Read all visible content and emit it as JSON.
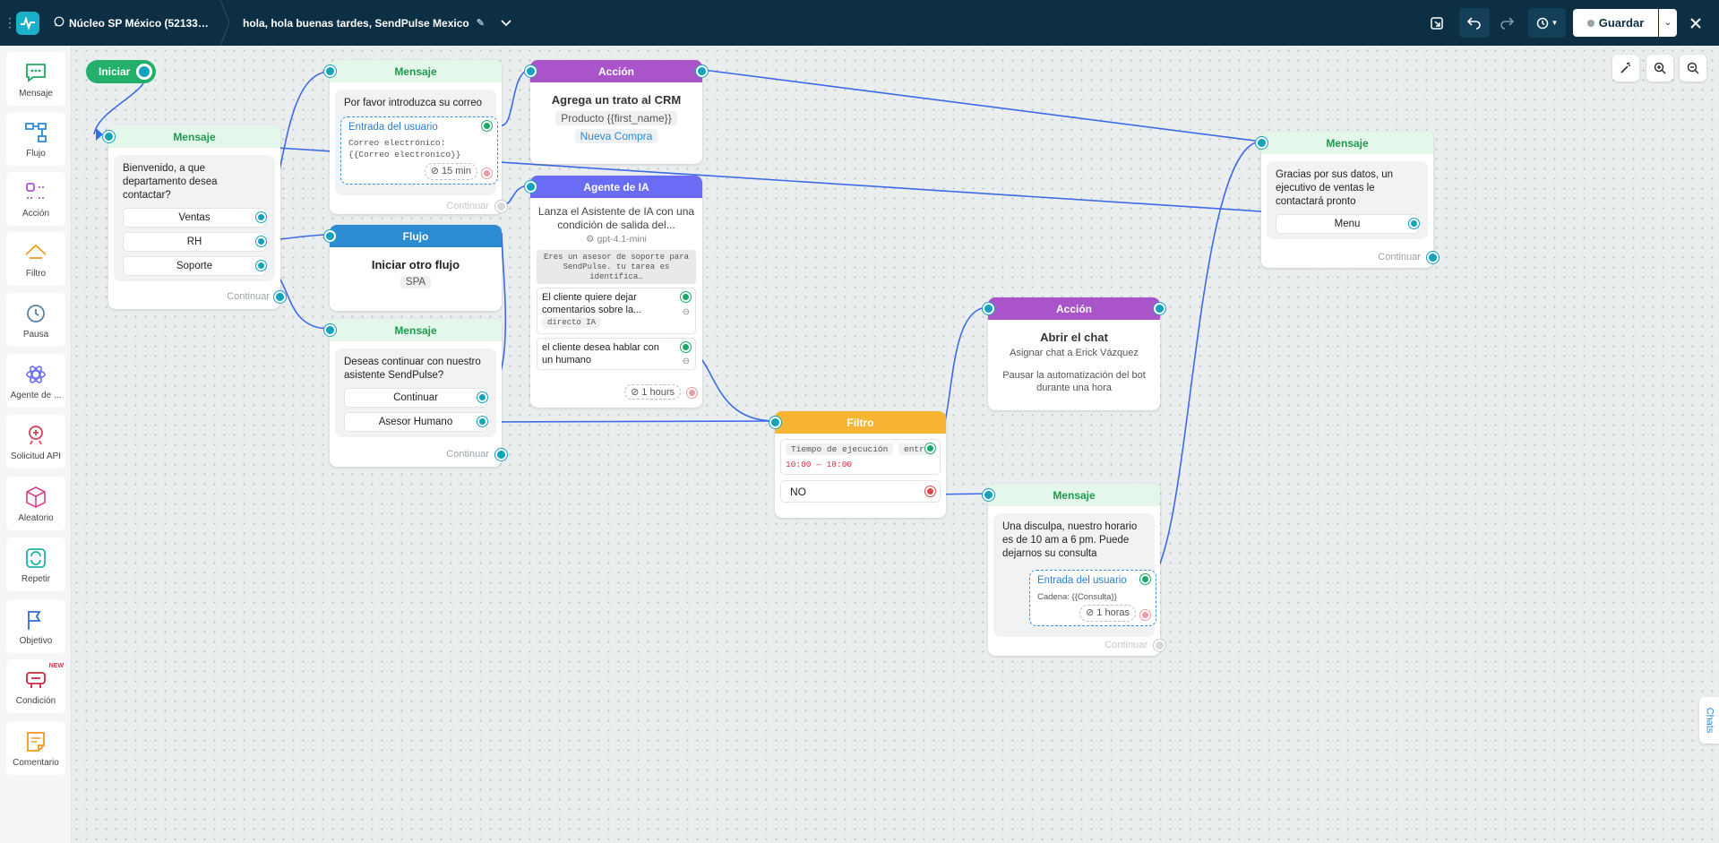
{
  "topbar": {
    "workspace": "Núcleo SP México (52133…",
    "flow_title": "hola, hola buenas tardes, SendPulse Mexico",
    "save_label": "Guardar"
  },
  "sidebar": {
    "items": [
      {
        "label": "Mensaje",
        "icon": "message-icon"
      },
      {
        "label": "Flujo",
        "icon": "flow-icon"
      },
      {
        "label": "Acción",
        "icon": "action-icon"
      },
      {
        "label": "Filtro",
        "icon": "filter-icon"
      },
      {
        "label": "Pausa",
        "icon": "clock-icon"
      },
      {
        "label": "Agente de ...",
        "icon": "ai-agent-icon"
      },
      {
        "label": "Solicitud API",
        "icon": "api-icon"
      },
      {
        "label": "Aleatorio",
        "icon": "dice-icon"
      },
      {
        "label": "Repetir",
        "icon": "repeat-icon"
      },
      {
        "label": "Objetivo",
        "icon": "flag-icon"
      },
      {
        "label": "Condición",
        "icon": "condition-icon",
        "badge": "NEW"
      },
      {
        "label": "Comentario",
        "icon": "comment-icon"
      }
    ]
  },
  "canvas": {
    "start_label": "Iniciar",
    "chats_tab": "Chats",
    "continue_label": "Continuar",
    "msg1": {
      "header": "Mensaje",
      "text": "Bienvenido, a que departamento desea contactar?",
      "buttons": [
        "Ventas",
        "RH",
        "Soporte"
      ]
    },
    "msg2": {
      "header": "Mensaje",
      "text": "Por favor introduzca su correo",
      "input_title": "Entrada del usuario",
      "input_body": "Correo electrónico: {{Correo electronico}}",
      "timer": "15 min"
    },
    "flow1": {
      "header": "Flujo",
      "title": "Iniciar otro flujo",
      "chip": "SPA"
    },
    "msg3": {
      "header": "Mensaje",
      "text": "Deseas continuar con nuestro asistente SendPulse?",
      "buttons": [
        "Continuar",
        "Asesor Humano"
      ]
    },
    "act1": {
      "header": "Acción",
      "title": "Agrega un trato al CRM",
      "product": "Producto {{first_name}}",
      "stage": "Nueva Compra"
    },
    "ai1": {
      "header": "Agente de IA",
      "text": "Lanza el Asistente de IA con una condición de salida del...",
      "model": "gpt-4.1-mini",
      "prompt": "Eres un asesor de soporte para SendPulse. tu tarea es identifica…",
      "cond1": "El cliente quiere dejar comentarios sobre la...",
      "cond1_tag": "directo IA",
      "cond2": "el cliente desea hablar con un humano",
      "timer": "1 hours"
    },
    "filter1": {
      "header": "Filtro",
      "cond_label": "Tiempo de ejecución",
      "cond_op": "entre",
      "cond_range": "10:00 — 18:00",
      "no_label": "NO"
    },
    "act2": {
      "header": "Acción",
      "title": "Abrir el chat",
      "line1": "Asignar chat a Erick Vázquez",
      "line2": "Pausar la automatización del bot durante  una hora"
    },
    "msg4": {
      "header": "Mensaje",
      "text": "Una disculpa, nuestro horario es de 10 am a 6 pm. Puede dejarnos su consulta",
      "input_title": "Entrada del usuario",
      "input_body": "Cadena: {{Consulta}}",
      "timer": "1 horas"
    },
    "msg5": {
      "header": "Mensaje",
      "text": "Gracias por sus datos, un ejecutivo de ventas le contactará pronto",
      "buttons": [
        "Menu"
      ]
    }
  },
  "colors": {
    "topbar": "#0c2f44",
    "accent": "#12a2bc",
    "wire": "#3d6ae8",
    "message": "#1f9a4f",
    "action": "#a954c8",
    "flow": "#2d8bd2",
    "ai": "#6b6cf5",
    "filter": "#f7b531"
  }
}
